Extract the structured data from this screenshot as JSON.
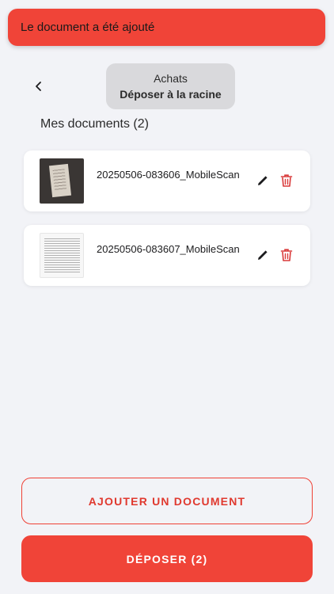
{
  "toast": {
    "message": "Le document a été ajouté"
  },
  "header": {
    "back_icon": "chevron-left-icon",
    "breadcrumb": {
      "folder": "Achats",
      "action": "Déposer à la racine"
    }
  },
  "documents": {
    "title": "Mes documents (2)",
    "items": [
      {
        "name": "20250506-083606_MobileScan",
        "thumbnail": "photo-receipt",
        "edit_icon": "pencil-icon",
        "delete_icon": "trash-icon"
      },
      {
        "name": "20250506-083607_MobileScan",
        "thumbnail": "scanned-document",
        "edit_icon": "pencil-icon",
        "delete_icon": "trash-icon"
      }
    ]
  },
  "actions": {
    "add_label": "AJOUTER UN DOCUMENT",
    "submit_label": "DÉPOSER (2)"
  },
  "colors": {
    "accent": "#f04438",
    "delete": "#d93a3a",
    "background": "#f2f3f7"
  }
}
